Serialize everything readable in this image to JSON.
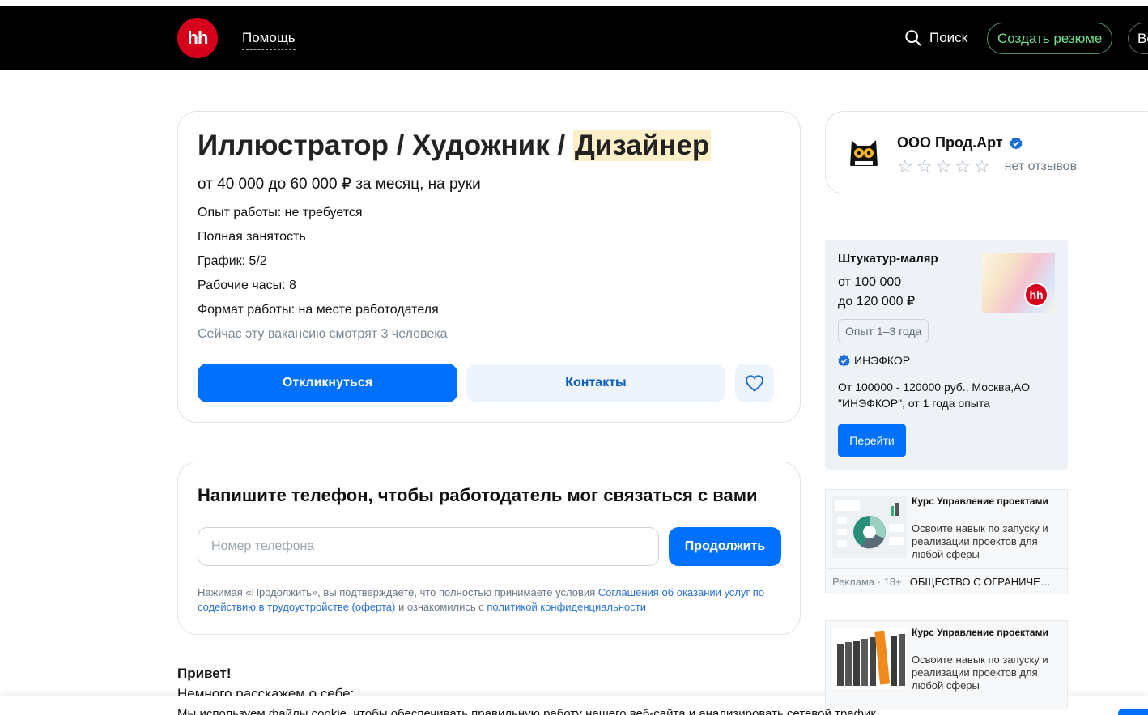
{
  "header": {
    "logo_text": "hh",
    "help_label": "Помощь",
    "search_label": "Поиск",
    "create_resume_label": "Создать резюме",
    "login_label": "Во"
  },
  "vacancy": {
    "title_part1": "Иллюстратор / Художник / ",
    "title_highlight": "Дизайнер",
    "salary": "от 40 000 до 60 000 ₽ за месяц, на руки",
    "experience": "Опыт работы: не требуется",
    "employment": "Полная занятость",
    "schedule": "График: 5/2",
    "hours": "Рабочие часы: 8",
    "format": "Формат работы: на месте работодателя",
    "viewers": "Сейчас эту вакансию смотрят 3 человека",
    "apply_label": "Откликнуться",
    "contacts_label": "Контакты"
  },
  "phone_form": {
    "title": "Напишите телефон, чтобы работодатель мог связаться с вами",
    "placeholder": "Номер телефона",
    "continue_label": "Продолжить",
    "legal_prefix": "Нажимая «Продолжить», вы подтверждаете, что полностью принимаете условия ",
    "legal_link1": "Соглашения об оказании услуг по содействию в трудоустройстве (оферта)",
    "legal_middle": " и ознакомились с ",
    "legal_link2": "политикой конфиденциальности"
  },
  "description": {
    "greeting": "Привет!",
    "about": "Немного расскажем о себе:"
  },
  "cookie": {
    "text": "Мы используем файлы cookie, чтобы обеспечивать правильную работу нашего веб-сайта и анализировать сетевой трафик"
  },
  "employer": {
    "name": "ООО Прод.Арт",
    "reviews": "нет отзывов",
    "rating_stars": 0
  },
  "ad_vacancy": {
    "title": "Штукатур-маляр",
    "salary_line1": "от 100 000",
    "salary_line2": "до 120 000 ₽",
    "badge": "hh",
    "experience": "Опыт 1–3 года",
    "company": "ИНЭФКОР",
    "description": "От 100000 - 120000 руб., Москва,АО \"ИНЭФКОР\", от 1 года опыта",
    "button": "Перейти"
  },
  "ads": [
    {
      "title": "Курс Управление проектами",
      "description": "Освоите навык по запуску и реализации проектов для любой сферы",
      "label": "Реклама · 18+",
      "org": "ОБЩЕСТВО С ОГРАНИЧЕННОЙ ОТВЕТСТВЕННОСТЬЮ"
    },
    {
      "title": "Курс Управление проектами",
      "description": "Освоите навык по запуску и реализации проектов для любой сферы"
    }
  ],
  "colors": {
    "brand_red": "#d6001c",
    "primary_blue": "#0070ff",
    "header_bg": "#000000",
    "resume_green": "#6ee08e",
    "highlight": "#fdefc8"
  }
}
